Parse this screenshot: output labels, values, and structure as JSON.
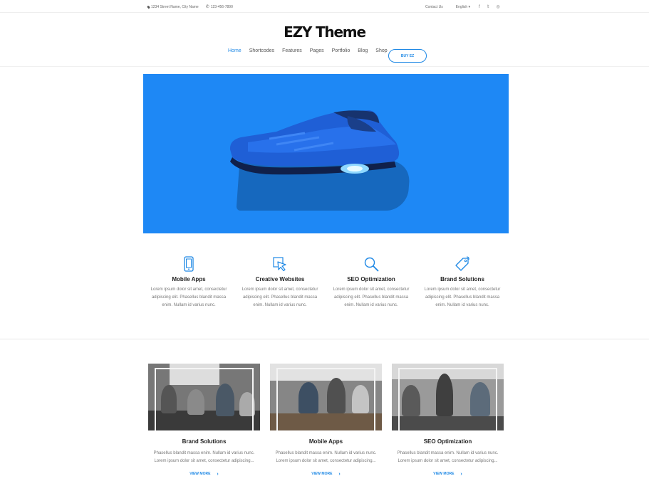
{
  "topbar": {
    "address": "1234 Street Name, City Name",
    "phone": "123-456-7890",
    "contact": "Contact Us",
    "language": "English ▾",
    "social": [
      "f",
      "t",
      "ig"
    ]
  },
  "header": {
    "logo": "EZY Theme",
    "nav": [
      "Home",
      "Shortcodes",
      "Features",
      "Pages",
      "Portfolio",
      "Blog",
      "Shop"
    ],
    "buy": "BUY EZ"
  },
  "features": [
    {
      "icon": "tablet-icon",
      "title": "Mobile Apps",
      "text": "Lorem ipsum dolor sit amet, consectetur adipiscing elit. Phasellus blandit massa enim. Nullam id varius nunc."
    },
    {
      "icon": "cursor-icon",
      "title": "Creative Websites",
      "text": "Lorem ipsum dolor sit amet, consectetur adipiscing elit. Phasellus blandit massa enim. Nullam id varius nunc."
    },
    {
      "icon": "search-icon",
      "title": "SEO Optimization",
      "text": "Lorem ipsum dolor sit amet, consectetur adipiscing elit. Phasellus blandit massa enim. Nullam id varius nunc."
    },
    {
      "icon": "tag-icon",
      "title": "Brand Solutions",
      "text": "Lorem ipsum dolor sit amet, consectetur adipiscing elit. Phasellus blandit massa enim. Nullam id varius nunc."
    }
  ],
  "cards": [
    {
      "title": "Brand Solutions",
      "text": "Phasellus blandit massa enim. Nullam id varius nunc. Lorem ipsum dolor sit amet, consectetur adipiscing...",
      "link": "VIEW MORE"
    },
    {
      "title": "Mobile Apps",
      "text": "Phasellus blandit massa enim. Nullam id varius nunc. Lorem ipsum dolor sit amet, consectetur adipiscing...",
      "link": "VIEW MORE"
    },
    {
      "title": "SEO Optimization",
      "text": "Phasellus blandit massa enim. Nullam id varius nunc. Lorem ipsum dolor sit amet, consectetur adipiscing...",
      "link": "VIEW MORE"
    }
  ],
  "colors": {
    "accent": "#1e88e5",
    "hero": "#1e88f5"
  }
}
